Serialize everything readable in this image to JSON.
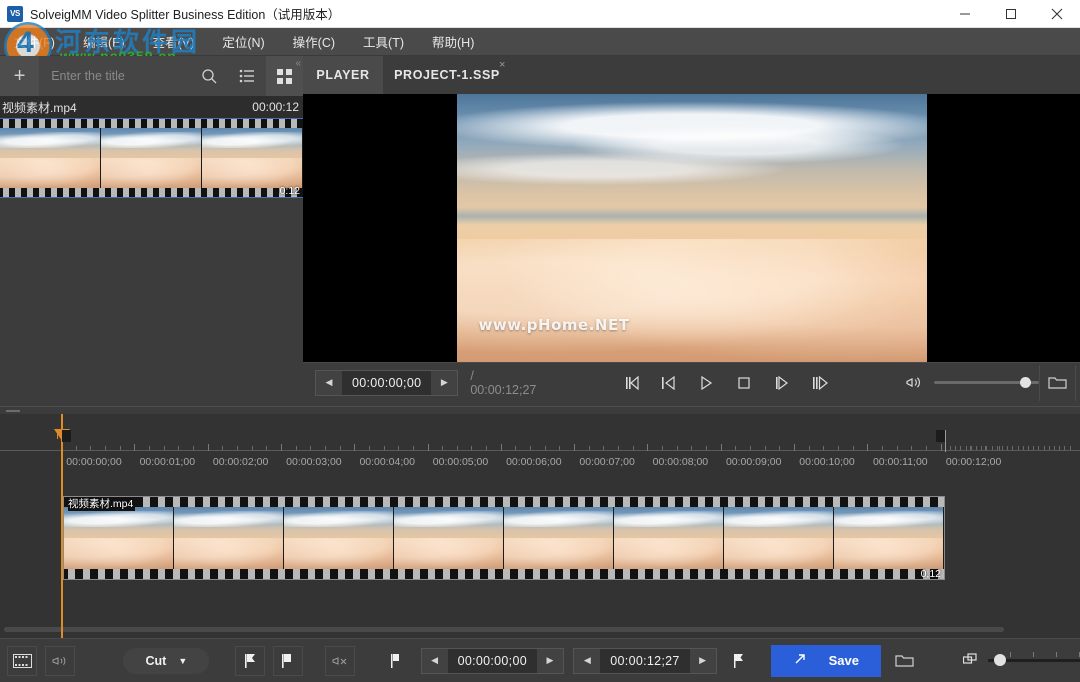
{
  "window": {
    "title": "SolveigMM Video Splitter Business Edition（试用版本）",
    "icon": "VS",
    "minimize": "minimize-icon",
    "maximize": "maximize-icon",
    "close": "close-icon"
  },
  "menubar": {
    "items": [
      {
        "label": "文件(F)",
        "accel": "F"
      },
      {
        "label": "编辑(E)",
        "accel": "E"
      },
      {
        "label": "查看(V)",
        "accel": "V"
      },
      {
        "label": "定位(N)",
        "accel": "N"
      },
      {
        "label": "操作(C)",
        "accel": "C"
      },
      {
        "label": "工具(T)",
        "accel": "T"
      },
      {
        "label": "帮助(H)",
        "accel": "H"
      }
    ]
  },
  "watermark": {
    "site_cn": "河东软件园",
    "site_url": "www.pc0359.cn",
    "video_overlay": "www.pHome.NET"
  },
  "media_panel": {
    "add_label": "+",
    "search_placeholder": "Enter the title",
    "search_value": "",
    "icons": [
      "search-icon",
      "list-view-icon",
      "grid-view-icon"
    ],
    "collapse_label": "«",
    "items": [
      {
        "name": "视频素材.mp4",
        "duration": "00:00:12",
        "strip_duration": "0:12"
      }
    ]
  },
  "player": {
    "tabs": [
      {
        "label": "PLAYER",
        "active": true,
        "closable": false
      },
      {
        "label": "PROJECT-1.SSP",
        "active": false,
        "closable": true,
        "close": "×"
      }
    ],
    "current_time": "00:00:00;00",
    "total_time_separator": "/",
    "total_time": "00:00:12;27",
    "prev_arrow": "◀",
    "next_arrow": "▶",
    "transport": [
      "step-back-frame-icon",
      "prev-keyframe-icon",
      "play-icon",
      "stop-icon",
      "next-keyframe-icon",
      "step-forward-frame-icon"
    ],
    "volume_icon": "volume-icon",
    "volume_percent": 82,
    "open_folder_icon": "folder-icon",
    "snapshot_icon": "camera-icon"
  },
  "timeline": {
    "playhead_time": "00:00:00;00",
    "ruler_labels": [
      "00:00:00;00",
      "00:00:01;00",
      "00:00:02;00",
      "00:00:03;00",
      "00:00:04;00",
      "00:00:05;00",
      "00:00:06;00",
      "00:00:07;00",
      "00:00:08;00",
      "00:00:09;00",
      "00:00:10;00",
      "00:00:11;00",
      "00:00:12;00"
    ],
    "clip": {
      "name": "视频素材.mp4",
      "duration": "0:12"
    }
  },
  "bottom_bar": {
    "filmstrip_icon": "filmstrip-icon",
    "audio_icon": "audio-waveform-icon",
    "mode_label": "Cut",
    "mode_caret": "▼",
    "marker_in_icon": "marker-in-icon",
    "marker_out_icon": "marker-out-icon",
    "mute_icon": "mute-icon",
    "flag_icon": "flag-icon",
    "start_time": "00:00:00;00",
    "end_time": "00:00:12;27",
    "end_flag_icon": "end-flag-icon",
    "save_label": "Save",
    "save_icon": "export-arrow-icon",
    "save_color": "#2b5fd9",
    "open_folder_icon": "folder-icon",
    "zoom_icon": "zoom-timeline-icon",
    "zoom_percent": 8
  }
}
